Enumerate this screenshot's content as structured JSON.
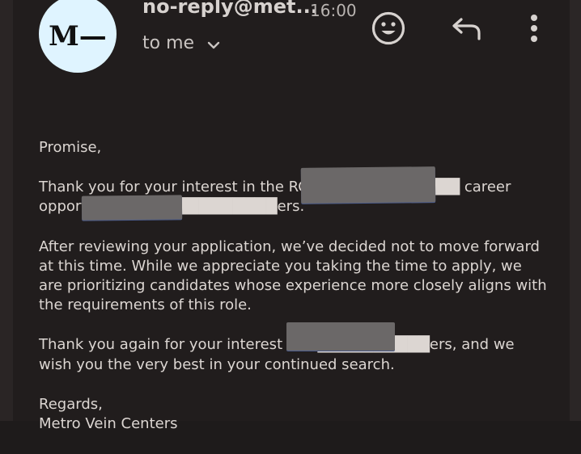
{
  "header": {
    "avatar_initials": "M—",
    "sender": "no-reply@met...",
    "time": "16:00",
    "recipient_label": "to me"
  },
  "icons": {
    "emoji": "smiley-face-icon",
    "reply": "reply-icon",
    "more": "more-vertical-icon",
    "expand": "chevron-down-icon"
  },
  "message": {
    "greeting": "Promise,",
    "para1": "Thank you for your interest in the RCM ████████████ career opportunity with M█████████ers.",
    "para2": "After reviewing your application, we’ve decided not to move forward at this time. While we appreciate you taking the time to apply, we are prioritizing candidates whose experience more closely aligns with the requirements of this role.",
    "para3": "Thank you again for your interest in M██████████ers, and we wish you the very best in your continued search.",
    "signoff": "Regards,",
    "signature": "Metro Vein Centers"
  },
  "colors": {
    "background": "#211d1d",
    "avatar": "#dff4ff",
    "text": "#dcd6d2",
    "redaction": "#6b6868"
  }
}
